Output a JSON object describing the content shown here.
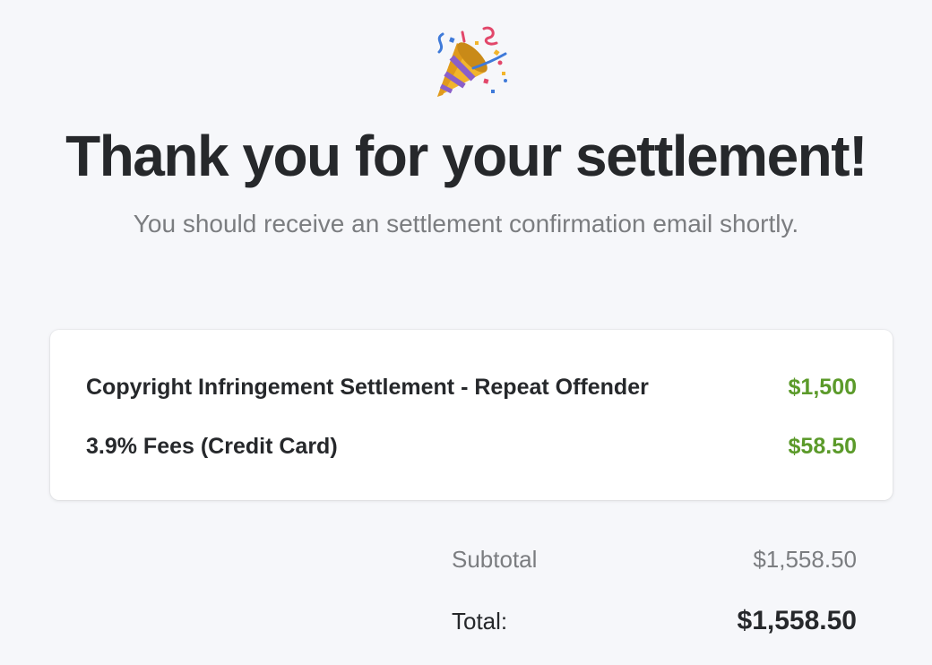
{
  "header": {
    "icon": "party-popper-icon",
    "title": "Thank you for your settlement!",
    "subtitle": "You should receive an settlement confirmation email shortly."
  },
  "line_items": [
    {
      "name": "Copyright Infringement Settlement - Repeat Offender",
      "price": "$1,500"
    },
    {
      "name": "3.9% Fees (Credit Card)",
      "price": "$58.50"
    }
  ],
  "summary": {
    "subtotal_label": "Subtotal",
    "subtotal_value": "$1,558.50",
    "total_label": "Total:",
    "total_value": "$1,558.50"
  },
  "colors": {
    "background": "#f6f7fa",
    "title": "#26282b",
    "muted": "#7b7d80",
    "price_accent": "#5b9a2a"
  }
}
